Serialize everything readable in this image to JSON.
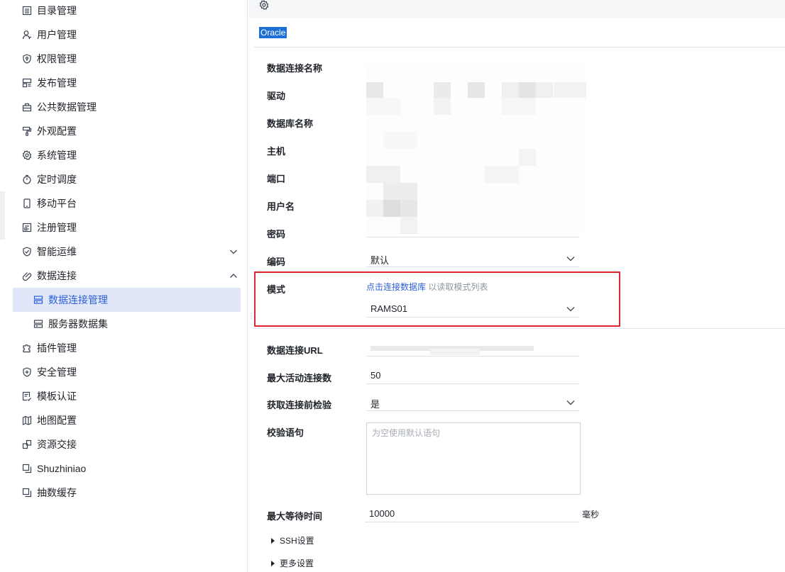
{
  "sidebar": {
    "items": [
      {
        "label": "目录管理",
        "icon": "catalog-icon"
      },
      {
        "label": "用户管理",
        "icon": "user-icon"
      },
      {
        "label": "权限管理",
        "icon": "shield-key-icon"
      },
      {
        "label": "发布管理",
        "icon": "publish-icon"
      },
      {
        "label": "公共数据管理",
        "icon": "public-data-icon"
      },
      {
        "label": "外观配置",
        "icon": "paint-roller-icon"
      },
      {
        "label": "系统管理",
        "icon": "gear-icon"
      },
      {
        "label": "定时调度",
        "icon": "timer-icon"
      },
      {
        "label": "移动平台",
        "icon": "mobile-icon"
      },
      {
        "label": "注册管理",
        "icon": "register-icon"
      },
      {
        "label": "智能运维",
        "icon": "ops-icon"
      },
      {
        "label": "数据连接",
        "icon": "link-icon"
      },
      {
        "label": "数据连接管理",
        "icon": "server-icon"
      },
      {
        "label": "服务器数据集",
        "icon": "server-icon"
      },
      {
        "label": "插件管理",
        "icon": "puzzle-icon"
      },
      {
        "label": "安全管理",
        "icon": "security-shield-icon"
      },
      {
        "label": "模板认证",
        "icon": "template-cert-icon"
      },
      {
        "label": "地图配置",
        "icon": "map-icon"
      },
      {
        "label": "资源交接",
        "icon": "resource-icon"
      },
      {
        "label": "Shuzhiniao",
        "icon": "copy-icon"
      },
      {
        "label": "抽数缓存",
        "icon": "copy-icon"
      }
    ]
  },
  "main": {
    "db_type": "Oracle",
    "fields": {
      "conn_name": {
        "label": "数据连接名称"
      },
      "driver": {
        "label": "驱动"
      },
      "db_name": {
        "label": "数据库名称"
      },
      "host": {
        "label": "主机"
      },
      "port": {
        "label": "端口"
      },
      "username": {
        "label": "用户名"
      },
      "password": {
        "label": "密码"
      },
      "encoding": {
        "label": "编码",
        "value": "默认"
      },
      "schema": {
        "label": "模式",
        "link": "点击连接数据库",
        "hint": "以读取模式列表",
        "value": "RAMS01"
      },
      "url": {
        "label": "数据连接URL"
      },
      "max_active": {
        "label": "最大活动连接数",
        "value": "50"
      },
      "test_before": {
        "label": "获取连接前检验",
        "value": "是"
      },
      "validation": {
        "label": "校验语句",
        "placeholder": "为空使用默认语句"
      },
      "max_wait": {
        "label": "最大等待时间",
        "value": "10000",
        "unit": "毫秒"
      }
    },
    "ssh_label": "SSH设置",
    "more_label": "更多设置"
  },
  "colors": {
    "accent": "#2c5fd5",
    "active_bg": "#dfe7f8",
    "highlight": "#e0252f",
    "db_tag": "#1d6fd6"
  }
}
